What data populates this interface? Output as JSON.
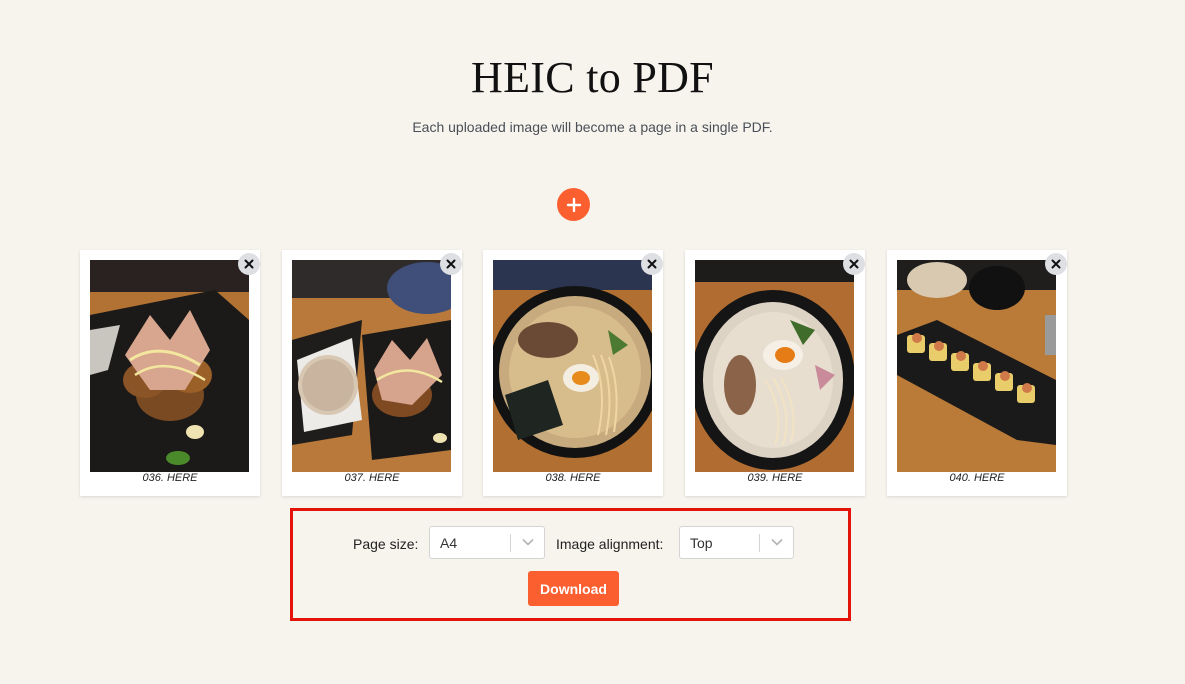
{
  "header": {
    "title": "HEIC to PDF",
    "subtitle": "Each uploaded image will become a page in a single PDF."
  },
  "add_button": {
    "icon": "plus-icon"
  },
  "images": [
    {
      "caption": "036. HERE",
      "subject": "takoyaki with bonito flakes"
    },
    {
      "caption": "037. HERE",
      "subject": "takoyaki and sugared bun"
    },
    {
      "caption": "038. HERE",
      "subject": "ramen with egg and seaweed"
    },
    {
      "caption": "039. HERE",
      "subject": "tonkotsu ramen with chashu"
    },
    {
      "caption": "040. HERE",
      "subject": "sushi roll platter"
    }
  ],
  "remove_icon": "close-icon",
  "options": {
    "page_size_label": "Page size:",
    "page_size_value": "A4",
    "alignment_label": "Image alignment:",
    "alignment_value": "Top"
  },
  "download_label": "Download",
  "colors": {
    "background": "#f7f4ee",
    "accent": "#fb5f30",
    "highlight_border": "#e3120b"
  }
}
